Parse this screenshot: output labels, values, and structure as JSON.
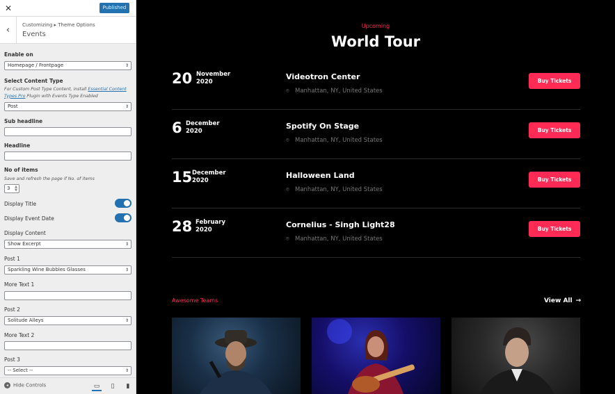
{
  "customizer": {
    "close_glyph": "✕",
    "publish_label": "Published",
    "back_glyph": "‹",
    "breadcrumb": "Customizing ▸ Theme Options",
    "section_title": "Events",
    "enable_on": {
      "label": "Enable on",
      "value": "Homepage / Frontpage"
    },
    "content_type": {
      "label": "Select Content Type",
      "desc_pre": "For Custom Post Type Content, install ",
      "desc_link": "Essential Content Types Pro",
      "desc_post": " Plugin with Events Type Enabled",
      "value": "Post"
    },
    "sub_headline": {
      "label": "Sub headline",
      "value": ""
    },
    "headline": {
      "label": "Headline",
      "value": ""
    },
    "no_items": {
      "label": "No of items",
      "desc": "Save and refresh the page if No. of items",
      "value": "3"
    },
    "display_title": {
      "label": "Display Title",
      "on": true
    },
    "display_event_date": {
      "label": "Display Event Date",
      "on": true
    },
    "display_content": {
      "label": "Display Content",
      "value": "Show Excerpt"
    },
    "post1": {
      "label": "Post 1",
      "value": "Sparkling Wine Bubbles Glasses"
    },
    "more_text1": {
      "label": "More Text 1",
      "value": ""
    },
    "post2": {
      "label": "Post 2",
      "value": "Solitude Alleys"
    },
    "more_text2": {
      "label": "More Text 2",
      "value": ""
    },
    "post3": {
      "label": "Post 3",
      "value": "-- Select --"
    },
    "footer": {
      "hide_controls": "Hide Controls"
    },
    "accent": "#2271b1"
  },
  "preview": {
    "eyebrow": "Upcoming",
    "title": "World Tour",
    "events": [
      {
        "day": "20",
        "month": "November",
        "year": "2020",
        "venue": "Videotron Center",
        "location": "Manhattan, NY, United States",
        "cta": "Buy Tickets"
      },
      {
        "day": "6",
        "month": "December",
        "year": "2020",
        "venue": "Spotify On Stage",
        "location": "Manhattan, NY, United States",
        "cta": "Buy Tickets"
      },
      {
        "day": "15",
        "month": "December",
        "year": "2020",
        "venue": "Halloween Land",
        "location": "Manhattan, NY, United States",
        "cta": "Buy Tickets"
      },
      {
        "day": "28",
        "month": "February",
        "year": "2020",
        "venue": "Cornelius - Singh Light28",
        "location": "Manhattan, NY, United States",
        "cta": "Buy Tickets"
      }
    ],
    "teams_label": "Awesome Teams",
    "view_all": "View All",
    "accent": "#ff2b55"
  }
}
